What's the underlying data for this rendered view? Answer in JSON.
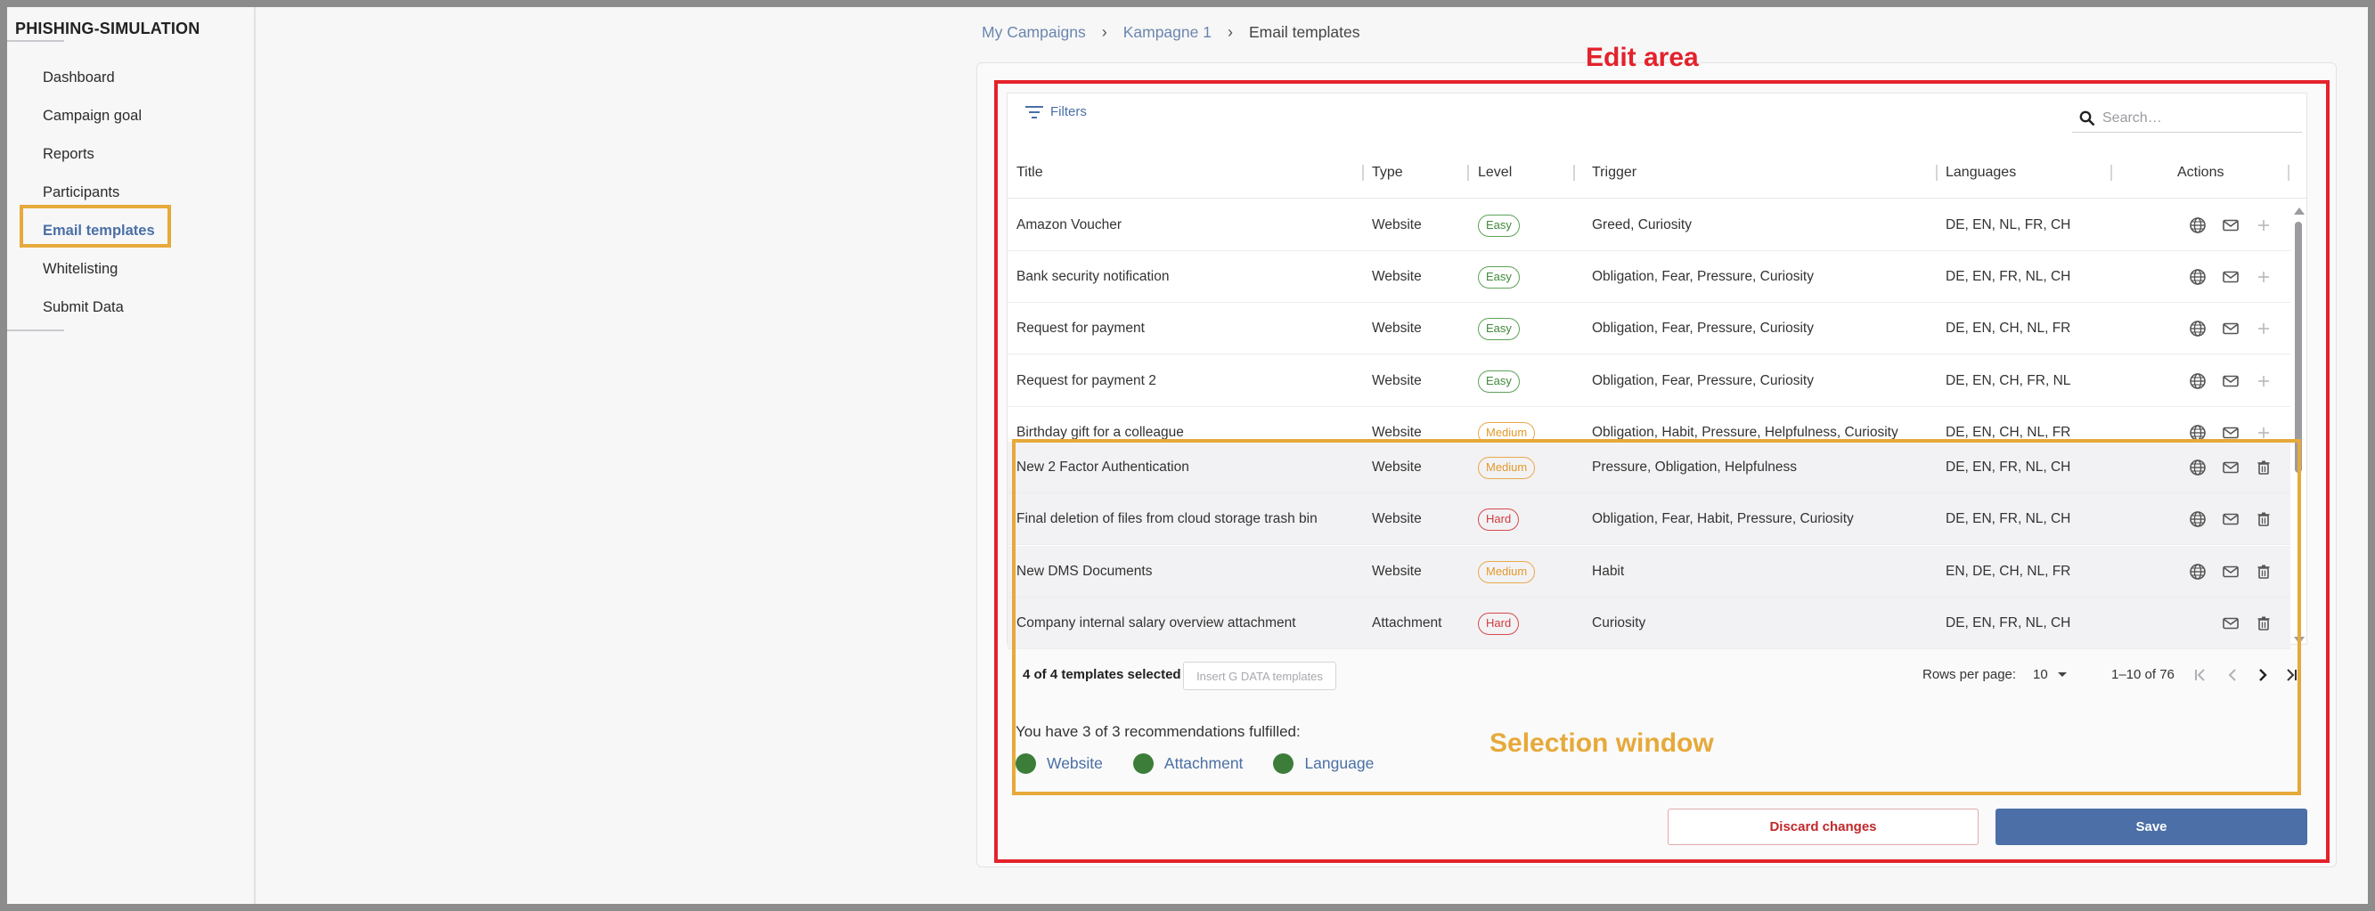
{
  "sidebar": {
    "brand": "PHISHING-SIMULATION",
    "items": [
      {
        "label": "Dashboard"
      },
      {
        "label": "Campaign goal"
      },
      {
        "label": "Reports"
      },
      {
        "label": "Participants"
      },
      {
        "label": "Email templates",
        "active": true
      },
      {
        "label": "Whitelisting"
      },
      {
        "label": "Submit Data"
      }
    ]
  },
  "breadcrumb": [
    "My Campaigns",
    "Kampagne 1",
    "Email templates"
  ],
  "annotations": {
    "edit_area": "Edit area",
    "selection_window": "Selection window",
    "edit_color": "#e3222b",
    "selection_color": "#e6a93a"
  },
  "toolbar": {
    "filters_label": "Filters",
    "search_placeholder": "Search…"
  },
  "table": {
    "headers": [
      "Title",
      "Type",
      "Level",
      "Trigger",
      "Languages",
      "Actions"
    ],
    "rows": [
      {
        "title": "Amazon Voucher",
        "type": "Website",
        "level": "Easy",
        "level_class": "easy",
        "trigger": "Greed, Curiosity",
        "languages": "DE, EN, NL, FR, CH",
        "action": "add"
      },
      {
        "title": "Bank security notification",
        "type": "Website",
        "level": "Easy",
        "level_class": "easy",
        "trigger": "Obligation, Fear, Pressure, Curiosity",
        "languages": "DE, EN, FR, NL, CH",
        "action": "add"
      },
      {
        "title": "Request for payment",
        "type": "Website",
        "level": "Easy",
        "level_class": "easy",
        "trigger": "Obligation, Fear, Pressure, Curiosity",
        "languages": "DE, EN, CH, NL, FR",
        "action": "add"
      },
      {
        "title": "Request for payment 2",
        "type": "Website",
        "level": "Easy",
        "level_class": "easy",
        "trigger": "Obligation, Fear, Pressure, Curiosity",
        "languages": "DE, EN, CH, FR, NL",
        "action": "add"
      },
      {
        "title": "Birthday gift for a colleague",
        "type": "Website",
        "level": "Medium",
        "level_class": "medium",
        "trigger": "Obligation, Habit, Pressure, Helpfulness, Curiosity",
        "languages": "DE, EN, CH, NL, FR",
        "action": "add"
      },
      {
        "title": "New 2 Factor Authentication",
        "type": "Website",
        "level": "Medium",
        "level_class": "medium",
        "trigger": "Pressure, Obligation, Helpfulness",
        "languages": "DE, EN, FR, NL, CH",
        "action": "delete"
      },
      {
        "title": "Final deletion of files from cloud storage trash bin",
        "type": "Website",
        "level": "Hard",
        "level_class": "hard",
        "trigger": "Obligation, Fear, Habit, Pressure, Curiosity",
        "languages": "DE, EN, FR, NL, CH",
        "action": "delete"
      },
      {
        "title": "New DMS Documents",
        "type": "Website",
        "level": "Medium",
        "level_class": "medium",
        "trigger": "Habit",
        "languages": "EN, DE, CH, NL, FR",
        "action": "delete"
      },
      {
        "title": "Company internal salary overview attachment",
        "type": "Attachment",
        "level": "Hard",
        "level_class": "hard",
        "trigger": "Curiosity",
        "languages": "DE, EN, FR, NL, CH",
        "action": "delete"
      }
    ]
  },
  "footer": {
    "selected_text": "4 of 4 templates selected",
    "insert_label": "Insert G DATA templates",
    "rows_per_page_label": "Rows per page:",
    "rows_per_page_value": "10",
    "range_text": "1–10 of 76"
  },
  "recommendations": {
    "text": "You have 3 of 3 recommendations fulfilled:",
    "items": [
      "Website",
      "Attachment",
      "Language"
    ],
    "dot_color": "#3c7d3a"
  },
  "actions": {
    "discard_label": "Discard changes",
    "save_label": "Save"
  }
}
